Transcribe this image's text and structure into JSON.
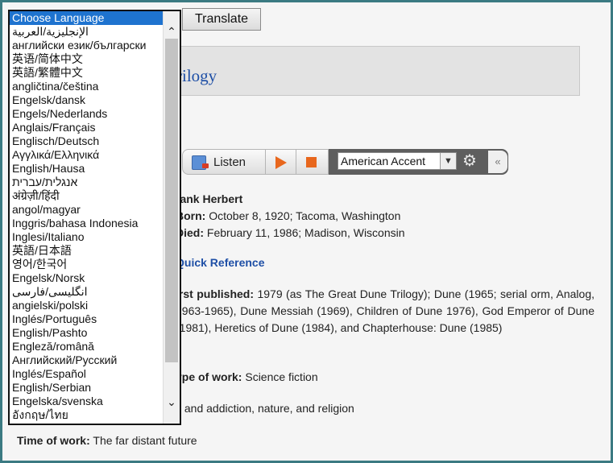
{
  "translate_button": "Translate",
  "title_fragment": "rilogy",
  "listen_bar": {
    "listen_label": "Listen",
    "accent": "American Accent"
  },
  "author": {
    "name": "rank Herbert",
    "born_label": "Born:",
    "born_value": "October 8, 1920; Tacoma, Washington",
    "died_label": "Died:",
    "died_value": "February 11, 1986; Madison, Wisconsin"
  },
  "quick_reference": "Quick Reference",
  "first_published_label": "irst published:",
  "first_published_text": "1979 (as The Great Dune Trilogy); Dune (1965; serial orm, Analog, 1963-1965), Dune Messiah (1969), Children of Dune 1976), God Emperor of Dune (1981), Heretics of Dune (1984), and Chapterhouse: Dune (1985)",
  "type_of_work_label": "ype of work:",
  "type_of_work_value": "Science fiction",
  "themes": "s and addiction, nature, and religion",
  "time_of_work_label": "Time of work:",
  "time_of_work_value": "The far distant future",
  "language_dropdown": {
    "options": [
      "Choose Language",
      "الإنجليزية/العربية",
      "английски език/български",
      "英语/简体中文",
      "英語/繁體中文",
      "angličtina/čeština",
      "Engelsk/dansk",
      "Engels/Nederlands",
      "Anglais/Français",
      "Englisch/Deutsch",
      "Αγγλικά/Ελληνικά",
      "English/Hausa",
      "אנגלית/עברית",
      "अंग्रेज़ी/हिंदी",
      "angol/magyar",
      "Inggris/bahasa Indonesia",
      "Inglesi/Italiano",
      "英語/日本語",
      "영어/한국어",
      "Engelsk/Norsk",
      "انگلیسی/فارسی",
      "angielski/polski",
      "Inglés/Português",
      "English/Pashto",
      "Engleză/română",
      "Английский/Русский",
      "Inglés/Español",
      "English/Serbian",
      "Engelska/svenska",
      "อังกฤษ/ไทย"
    ]
  }
}
